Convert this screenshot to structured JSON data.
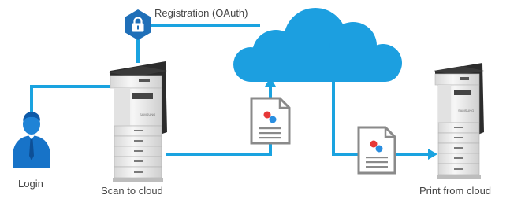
{
  "labels": {
    "registration": "Registration (OAuth)",
    "login": "Login",
    "scan_to_cloud": "Scan to cloud",
    "print_from_cloud": "Print from cloud"
  },
  "colors": {
    "flow": "#1aa3e0",
    "cloud": "#1c9fe0",
    "shield": "#1f6fb8",
    "user": "#1773c8",
    "printer_body": "#f1f1f1",
    "printer_dark": "#2c2c2c",
    "document_border": "#8a8a8a",
    "doc_red": "#e63838",
    "doc_blue": "#2a8ee0",
    "text": "#444444"
  },
  "icons": [
    "lock-shield-icon",
    "cloud-icon",
    "user-icon",
    "printer-icon",
    "document-icon"
  ]
}
